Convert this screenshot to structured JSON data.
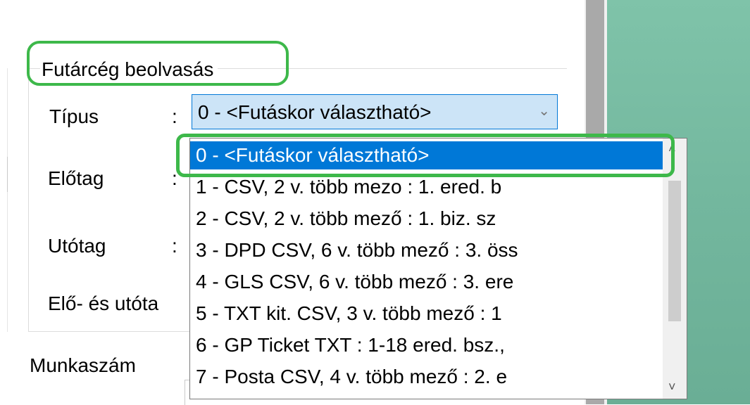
{
  "group": {
    "title": "Futárcég beolvasás"
  },
  "fields": [
    {
      "label": "Típus",
      "colon": ":"
    },
    {
      "label": "Előtag",
      "colon": ":"
    },
    {
      "label": "Utótag",
      "colon": ":"
    },
    {
      "label": "Elő- és utóta"
    }
  ],
  "munkaszam_label": "Munkaszám",
  "combo": {
    "value": "0 - <Futáskor választható>",
    "arrow": "⌄"
  },
  "options": [
    "0 - <Futáskor választható>",
    "1 - CSV, 2 v. több mezo : 1. ered. b",
    "2 - CSV, 2 v. több mező : 1. biz. sz",
    "3 - DPD CSV, 6 v. több mező : 3. öss",
    "4 - GLS CSV, 6 v. több mező : 3. ere",
    "5 - TXT kit. CSV, 3 v. több mező : 1",
    "6 - GP Ticket TXT : 1-18 ered. bsz.,",
    "7 - Posta CSV, 4 v. több mező : 2. e"
  ],
  "selected_index": 0,
  "scroll": {
    "up": "˄",
    "down": "˅"
  },
  "colors": {
    "highlight": "#3db84a",
    "selection": "#0078d7",
    "teal": "#73b79e"
  }
}
